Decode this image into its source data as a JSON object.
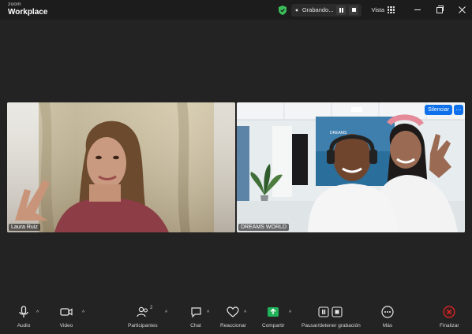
{
  "app": {
    "brand_small": "zoom",
    "brand_big": "Workplace"
  },
  "titlebar": {
    "recording_label": "Grabando...",
    "view_label": "Vista"
  },
  "participants": [
    {
      "name": "Laura Ruiz"
    },
    {
      "name": "DREAMS WORLD",
      "action_label": "Silenciar",
      "more_label": "..."
    }
  ],
  "toolbar": {
    "audio": "Audio",
    "video": "Video",
    "participants": "Participantes",
    "participants_count": "2",
    "chat": "Chat",
    "react": "Reaccionar",
    "share": "Compartir",
    "pause_stop_recording": "Pausar/detener grabación",
    "more": "Más",
    "end": "Finalizar"
  },
  "colors": {
    "share_green": "#20b15a",
    "end_red": "#e02828",
    "accent_blue": "#0e71eb",
    "shield_green": "#3bbf5a"
  }
}
